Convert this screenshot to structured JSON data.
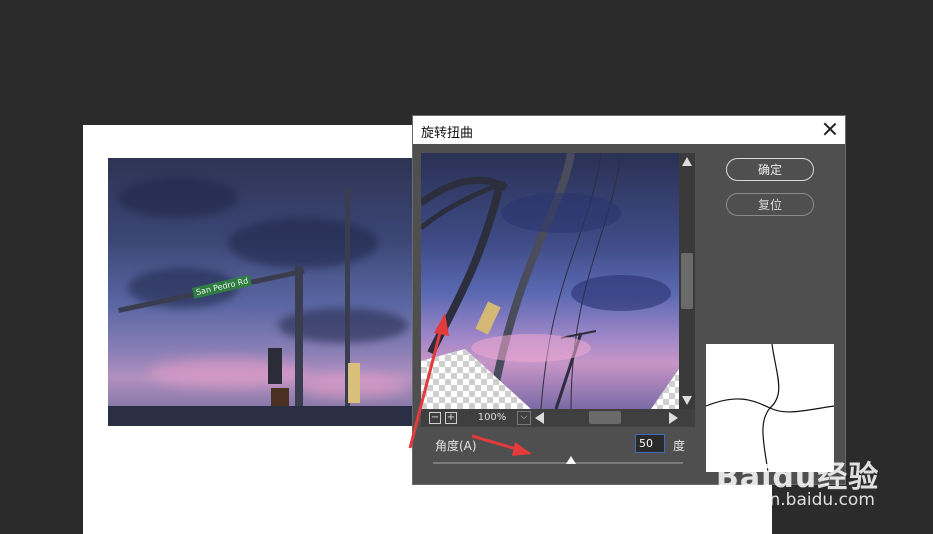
{
  "dialog": {
    "title": "旋转扭曲",
    "ok_label": "确定",
    "reset_label": "复位",
    "zoom": {
      "minus": "−",
      "plus": "+",
      "value": "100%",
      "dropdown": "⌵"
    },
    "angle": {
      "label": "角度(A)",
      "value": "50",
      "unit": "度",
      "slider_fraction": 0.55
    }
  },
  "canvas_photo": {
    "street_sign": "San Pedro Rd"
  },
  "watermark": {
    "brand": "Baidu经验",
    "url": "jingyan.baidu.com"
  },
  "annotation_color": "#e23b3b"
}
